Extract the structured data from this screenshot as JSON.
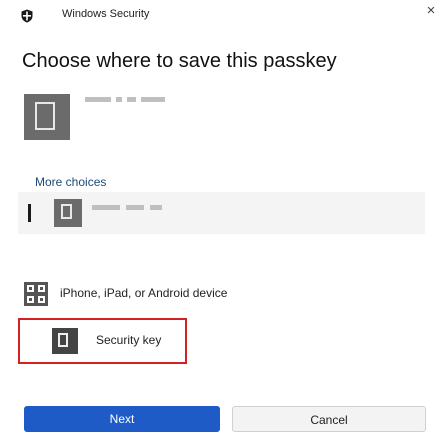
{
  "window": {
    "title": "Windows Security",
    "close_glyph": "×",
    "shield_icon": "windows-security-shield-icon"
  },
  "heading": "Choose where to save this passkey",
  "primary_option": {
    "icon": "device-icon",
    "label_obscured": true
  },
  "more_choices_label": "More choices",
  "options": [
    {
      "icon": "device-icon",
      "label_obscured": true,
      "selected": true
    },
    {
      "icon": "qr-code-icon",
      "label": "iPhone, iPad, or Android device"
    },
    {
      "icon": "security-key-icon",
      "label": "Security key",
      "highlighted": true
    }
  ],
  "buttons": {
    "next": "Next",
    "cancel": "Cancel"
  },
  "colors": {
    "accent": "#1f5bc6",
    "highlight_border": "#d42020",
    "link": "#1a4a7a"
  }
}
